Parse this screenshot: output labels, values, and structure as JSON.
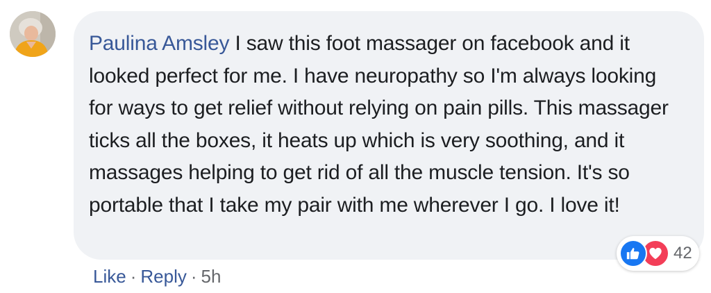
{
  "comment": {
    "author": "Paulina Amsley",
    "text": "I saw this foot massager on facebook and it looked perfect for me. I have neuropathy so I'm always looking for ways to get relief without relying on pain pills. This massager ticks all the boxes, it heats up which is very soothing, and it massages helping to get rid of all the muscle tension. It's so portable that I take my pair with me wherever I go. I love it!",
    "reactions": {
      "icons": [
        "like-icon",
        "love-icon"
      ],
      "count": "42"
    },
    "actions": {
      "like": "Like",
      "reply": "Reply",
      "separator": "·",
      "time": "5h"
    }
  },
  "colors": {
    "bubble": "#f0f2f5",
    "author": "#385898",
    "text": "#1c1e21",
    "meta": "#65676b",
    "like": "#1877f2",
    "love": "#f33e58"
  }
}
